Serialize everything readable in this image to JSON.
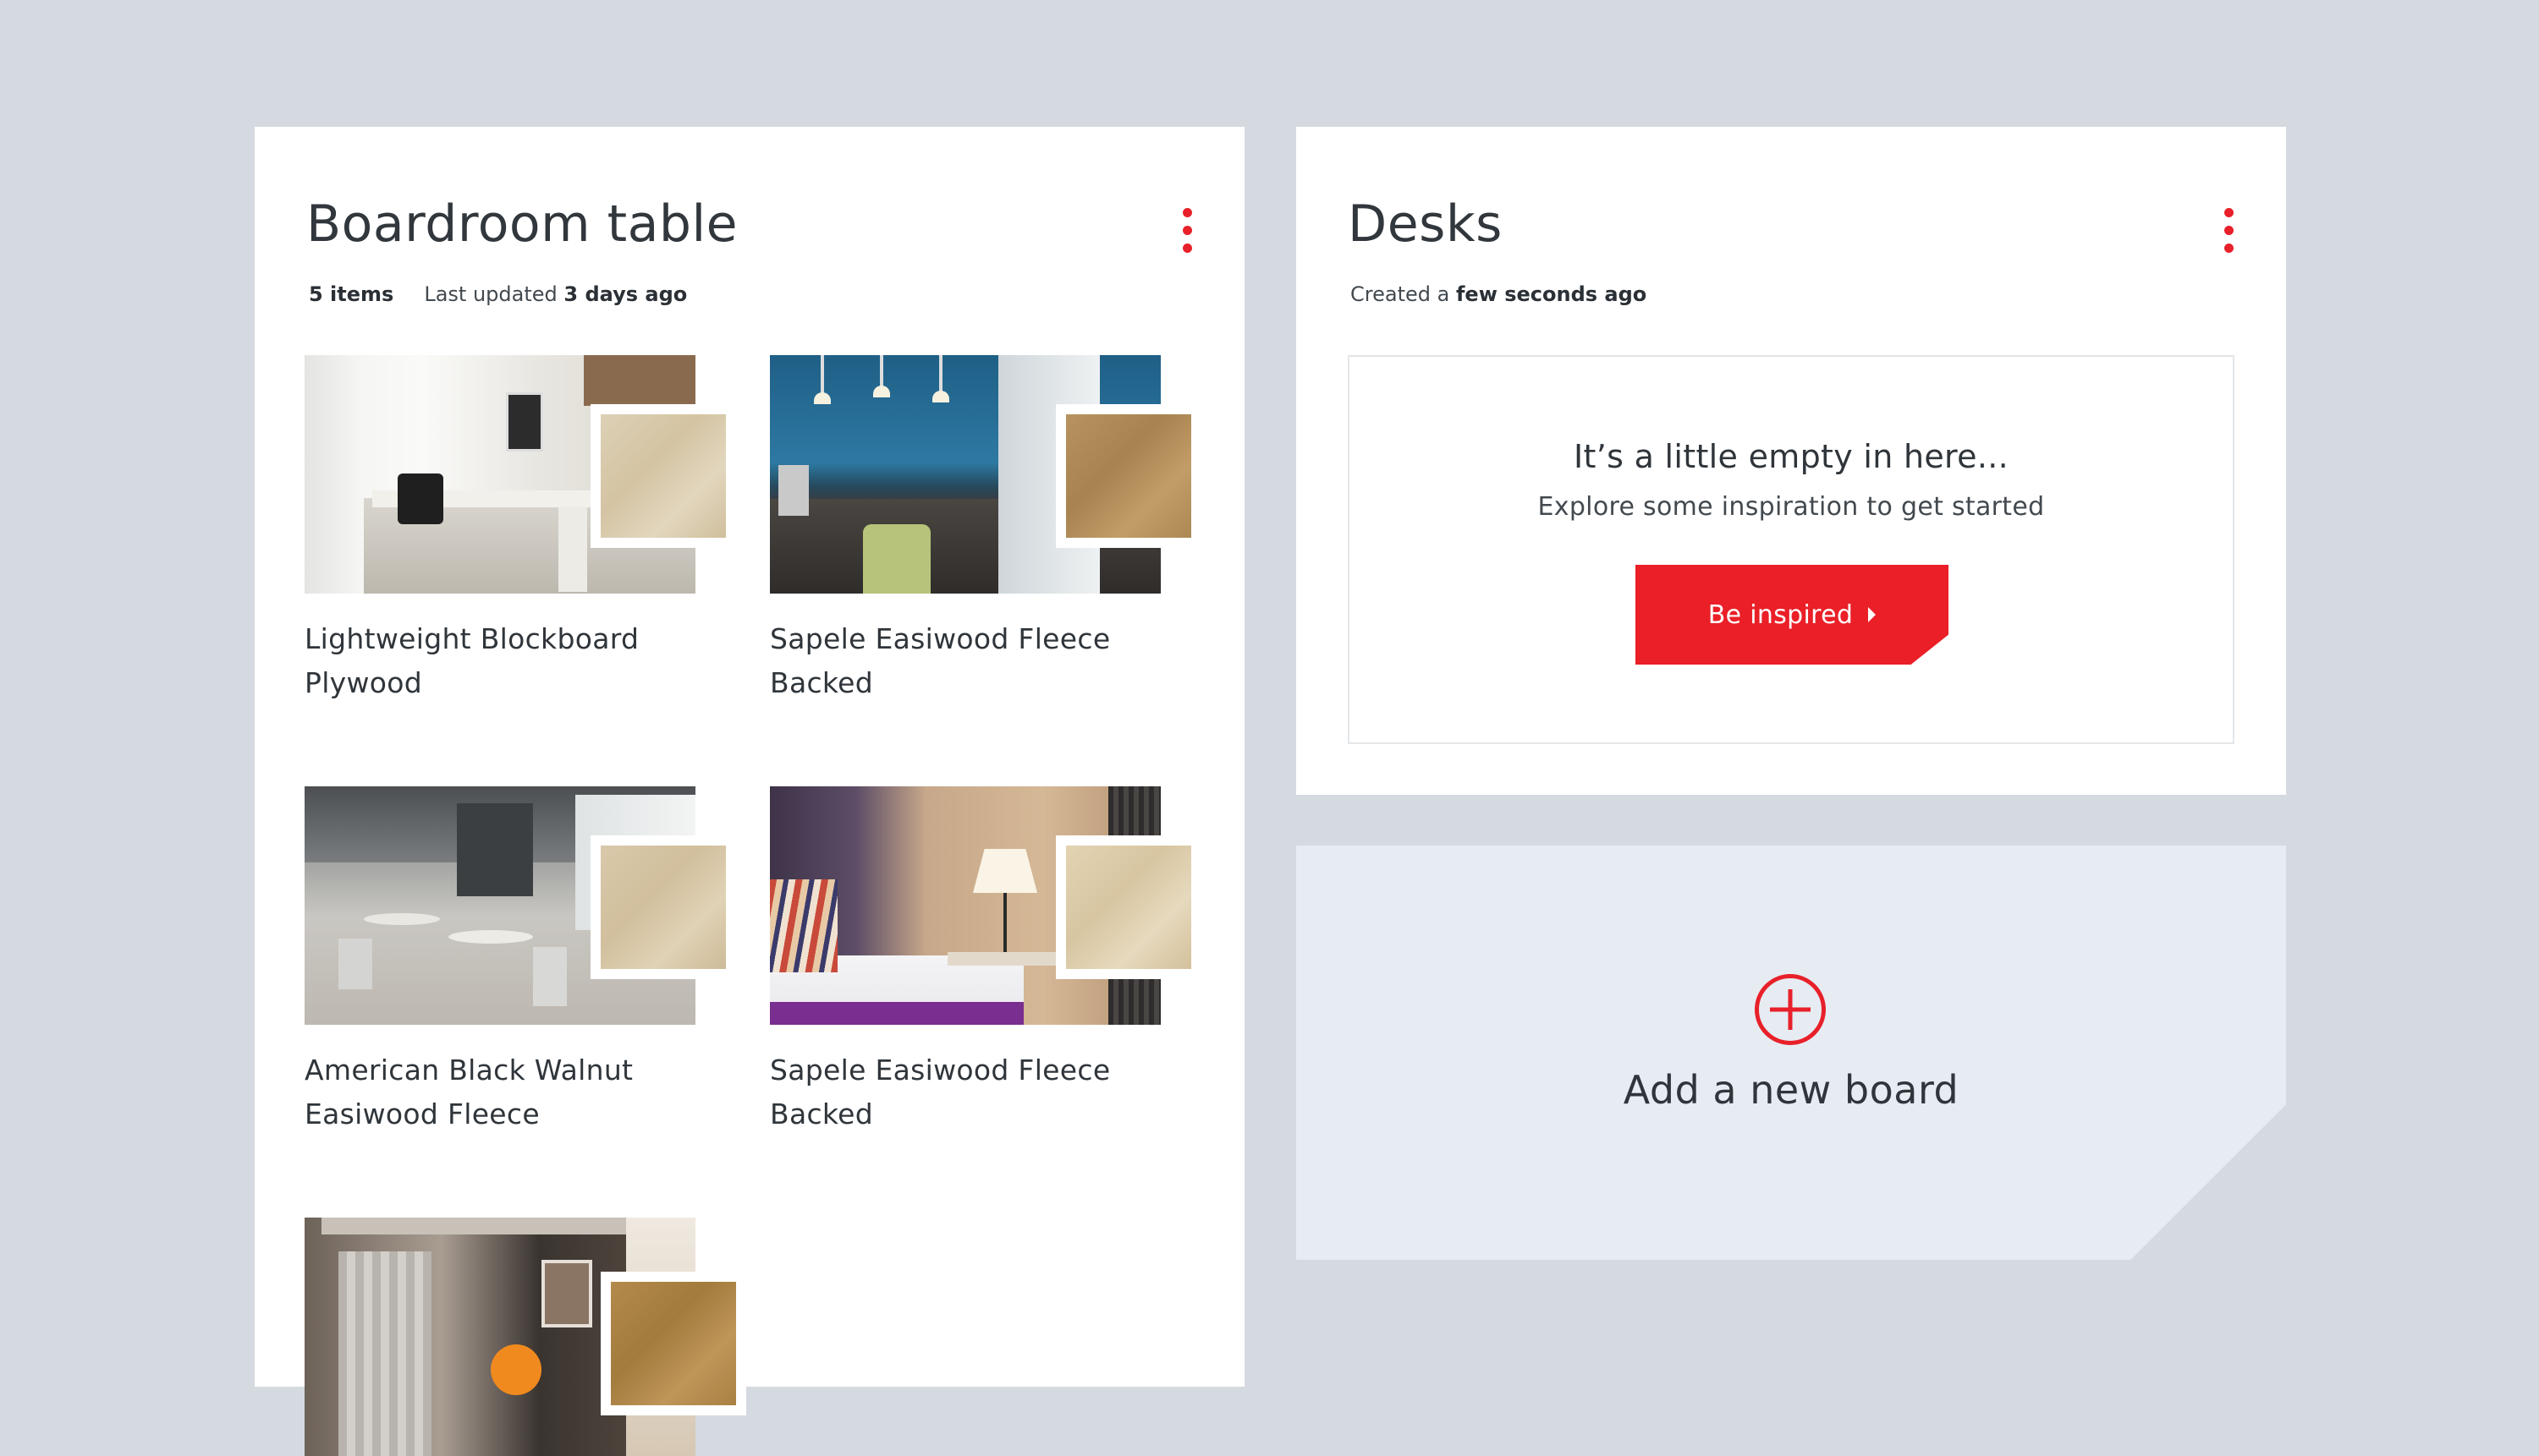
{
  "boards": {
    "boardroom": {
      "title": "Boardroom table",
      "item_count": "5 items",
      "updated_prefix": "Last updated",
      "updated_value": "3 days ago",
      "items": [
        {
          "name": "Lightweight Blockboard Plywood"
        },
        {
          "name": "Sapele Easiwood Fleece Backed"
        },
        {
          "name": "American Black Walnut Easiwood Fleece"
        },
        {
          "name": "Sapele Easiwood Fleece Backed"
        },
        {
          "name": ""
        }
      ]
    },
    "desks": {
      "title": "Desks",
      "created_prefix": "Created a",
      "created_value": "few seconds ago",
      "empty_title": "It’s a little empty in here...",
      "empty_subtitle": "Explore some inspiration to get started",
      "cta_label": "Be inspired"
    }
  },
  "add_board": {
    "label": "Add a new board"
  },
  "colors": {
    "accent": "#e8202a",
    "background": "#d4dae0",
    "card": "#ffffff",
    "add_board_bg": "#e6ecf2"
  },
  "icons": {
    "menu": "kebab-menu-icon",
    "add": "plus-circle-icon",
    "cta": "caret-right-icon"
  }
}
